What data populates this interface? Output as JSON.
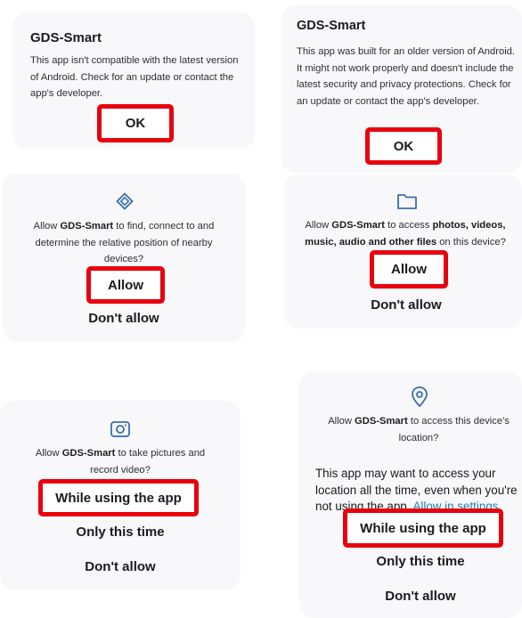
{
  "dialog1": {
    "title": "GDS-Smart",
    "message": "This app isn't compatible with the latest version of Android. Check for an update or contact the app's developer.",
    "ok_label": "OK"
  },
  "dialog2": {
    "title": "GDS-Smart",
    "message": "This app was built for an older version of Android. It might not work properly and doesn't include the latest security and privacy protections. Check for an update or contact the app's developer.",
    "ok_label": "OK"
  },
  "dialog3": {
    "icon": "nearby-devices-icon",
    "msg_prefix": "Allow ",
    "app_name": "GDS-Smart",
    "msg_suffix": " to find, connect to and determine the relative position of nearby devices?",
    "allow_label": "Allow",
    "deny_label": "Don't allow"
  },
  "dialog4": {
    "icon": "folder-icon",
    "msg_prefix": "Allow ",
    "app_name": "GDS-Smart",
    "msg_middle": " to access ",
    "msg_bold": "photos, videos, music, audio and other files",
    "msg_suffix": " on this device?",
    "allow_label": "Allow",
    "deny_label": "Don't allow"
  },
  "dialog5": {
    "icon": "camera-icon",
    "msg_prefix": "Allow ",
    "app_name": "GDS-Smart",
    "msg_suffix": " to take pictures and record video?",
    "while_label": "While using the app",
    "once_label": "Only this time",
    "deny_label": "Don't allow"
  },
  "dialog6": {
    "icon": "location-pin-icon",
    "msg_prefix": "Allow ",
    "app_name": "GDS-Smart",
    "msg_suffix": " to access this device's location?",
    "background_note": "This app may want to access your location all the time, even when you're not using the app. ",
    "settings_link": "Allow in settings.",
    "while_label": "While using the app",
    "once_label": "Only this time",
    "deny_label": "Don't allow"
  },
  "colors": {
    "highlight": "#e8000e",
    "card_bg": "#f8f8fb",
    "icon_blue": "#3c6ea8",
    "link": "#1f7fb5"
  }
}
